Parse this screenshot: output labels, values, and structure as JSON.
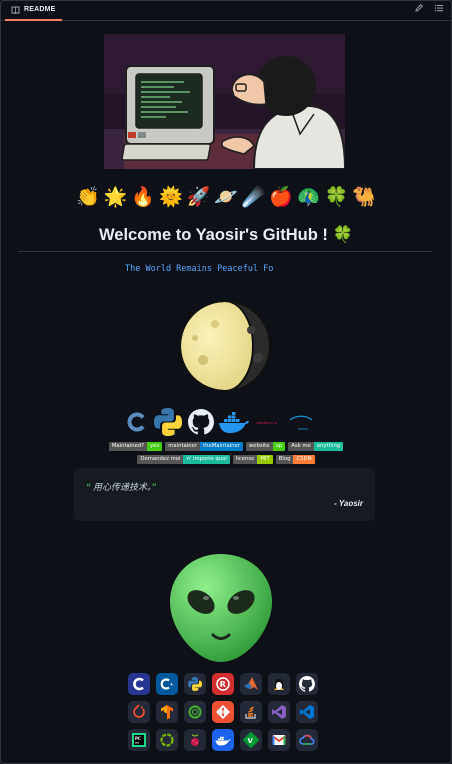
{
  "tab": {
    "label": "README"
  },
  "toolbar": {
    "edit_icon": "pencil-icon",
    "outline_icon": "list-icon"
  },
  "header": {
    "emoji": [
      "👏",
      "🌟",
      "🔥",
      "🌞",
      "🚀",
      "🪐",
      "☄️",
      "🍎",
      "🦚",
      "🍀",
      "🐫"
    ],
    "title": "Welcome to Yaosir's GitHub ! 🍀"
  },
  "typing": {
    "text": "The World Remains Peaceful Fo"
  },
  "tech_logos": {
    "names": [
      "c-logo",
      "python-logo",
      "github-logo",
      "docker-logo",
      "raspberry-pi-logo",
      "arch-logo"
    ],
    "raspberry_text": "raspberry pi"
  },
  "badges_row1": [
    {
      "label": "Maintained?",
      "value": "yes",
      "color": "#4c1"
    },
    {
      "label": "maintainer",
      "value": "theMaintainer",
      "color": "#007ec6"
    },
    {
      "label": "website",
      "value": "up",
      "color": "#4c1"
    },
    {
      "label": "Ask me",
      "value": "anything",
      "color": "#1abc9c"
    }
  ],
  "badges_row2": [
    {
      "label": "Demandez moi",
      "value": "n' importe quoi",
      "color": "#1abc9c"
    },
    {
      "label": "license",
      "value": "MIT",
      "color": "#97ca00"
    },
    {
      "label": "Blog",
      "value": "CSDN",
      "color": "#fe7d37"
    }
  ],
  "quote": {
    "open": "“",
    "text": "用心传递技术。",
    "close": "”",
    "author": "- Yaosir"
  },
  "skills": [
    "c-icon",
    "cpp-icon",
    "python-icon",
    "rust-icon",
    "matlab-icon",
    "linux-icon",
    "github-icon",
    "pytorch-icon",
    "tensorflow-icon",
    "anaconda-icon",
    "git-icon",
    "stackoverflow-icon",
    "visualstudio-icon",
    "vscode-icon",
    "pycharm-icon",
    "nvidia-icon",
    "raspberrypi-icon",
    "docker-icon",
    "vim-icon",
    "gmail-icon",
    "gcp-icon"
  ],
  "colors": {
    "background": "#0d1117",
    "accent": "#f78166",
    "link": "#58a6ff"
  }
}
